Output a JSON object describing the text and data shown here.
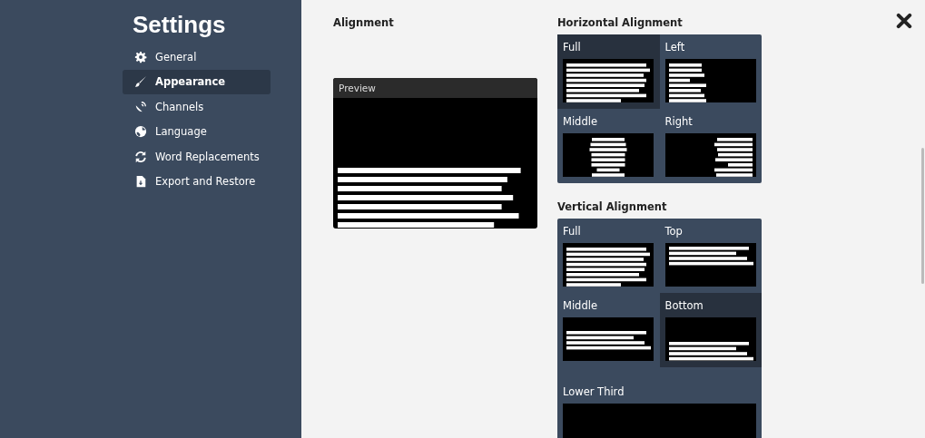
{
  "sidebar": {
    "title": "Settings",
    "items": [
      {
        "label": "General",
        "kind": "gear",
        "selected": false
      },
      {
        "label": "Appearance",
        "kind": "brush",
        "selected": true
      },
      {
        "label": "Channels",
        "kind": "dish",
        "selected": false
      },
      {
        "label": "Language",
        "kind": "globe",
        "selected": false
      },
      {
        "label": "Word Replacements",
        "kind": "refresh",
        "selected": false
      },
      {
        "label": "Export and Restore",
        "kind": "file",
        "selected": false
      }
    ]
  },
  "alignment": {
    "heading": "Alignment",
    "preview": {
      "label": "Preview"
    }
  },
  "horizontal_alignment": {
    "heading": "Horizontal Alignment",
    "options": [
      {
        "label": "Full",
        "kind": "full",
        "selected": true
      },
      {
        "label": "Left",
        "kind": "left",
        "selected": false
      },
      {
        "label": "Middle",
        "kind": "center",
        "selected": false
      },
      {
        "label": "Right",
        "kind": "right",
        "selected": false
      }
    ]
  },
  "vertical_alignment": {
    "heading": "Vertical Alignment",
    "options": [
      {
        "label": "Full",
        "kind": "full",
        "selected": false
      },
      {
        "label": "Top",
        "kind": "top",
        "selected": false
      },
      {
        "label": "Middle",
        "kind": "middle",
        "selected": false
      },
      {
        "label": "Bottom",
        "kind": "bottom",
        "selected": true
      },
      {
        "label": "Lower Third",
        "kind": "lower-third",
        "selected": false
      }
    ]
  }
}
